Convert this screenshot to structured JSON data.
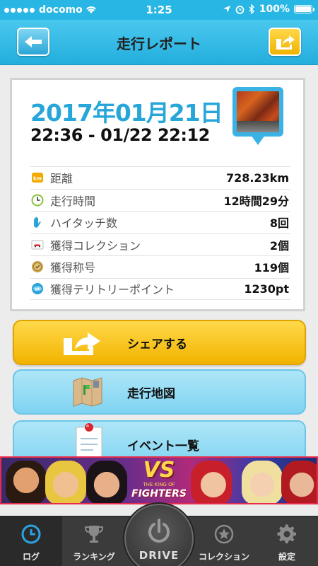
{
  "status_bar": {
    "carrier": "docomo",
    "time": "1:25",
    "battery": "100%"
  },
  "header": {
    "title": "走行レポート",
    "back_icon": "arrow-left-icon",
    "share_icon": "share-arrow-icon"
  },
  "report": {
    "date": "2017年01月21日",
    "time_range": "22:36 - 01/22 22:12",
    "stats": [
      {
        "icon": "km-icon",
        "label": "距離",
        "value": "728.23km"
      },
      {
        "icon": "clock-icon",
        "label": "走行時間",
        "value": "12時間29分"
      },
      {
        "icon": "hand-icon",
        "label": "ハイタッチ数",
        "value": "8回"
      },
      {
        "icon": "car-card-icon",
        "label": "獲得コレクション",
        "value": "2個"
      },
      {
        "icon": "medal-icon",
        "label": "獲得称号",
        "value": "119個"
      },
      {
        "icon": "point-icon",
        "label": "獲得テリトリーポイント",
        "value": "1230pt"
      }
    ]
  },
  "buttons": {
    "share": "シェアする",
    "map": "走行地図",
    "events": "イベント一覧"
  },
  "banner": {
    "logo_vs": "VS",
    "logo_title": "FIGHTERS",
    "logo_small": "THE KING OF"
  },
  "tabs": {
    "log": "ログ",
    "ranking": "ランキング",
    "drive": "DRIVE",
    "collection": "コレクション",
    "settings": "設定"
  },
  "colors": {
    "accent": "#27a6d9",
    "header": "#28b6e4",
    "share_yellow": "#f2b300",
    "tabbar": "#3b3b3b"
  }
}
